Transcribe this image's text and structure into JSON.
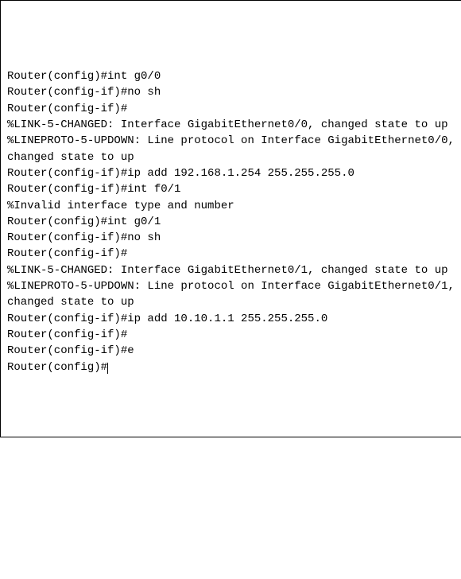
{
  "terminal": {
    "lines": [
      "Router(config)#int g0/0",
      "Router(config-if)#no sh",
      "",
      "Router(config-if)#",
      "%LINK-5-CHANGED: Interface GigabitEthernet0/0, changed state to up",
      "",
      "%LINEPROTO-5-UPDOWN: Line protocol on Interface GigabitEthernet0/0, changed state to up",
      "",
      "Router(config-if)#ip add 192.168.1.254 255.255.255.0",
      "Router(config-if)#int f0/1",
      "%Invalid interface type and number",
      "Router(config)#int g0/1",
      "Router(config-if)#no sh",
      "",
      "Router(config-if)#",
      "%LINK-5-CHANGED: Interface GigabitEthernet0/1, changed state to up",
      "",
      "%LINEPROTO-5-UPDOWN: Line protocol on Interface GigabitEthernet0/1, changed state to up",
      "",
      "Router(config-if)#ip add 10.10.1.1 255.255.255.0",
      "Router(config-if)#",
      "Router(config-if)#e",
      "Router(config)#"
    ]
  }
}
